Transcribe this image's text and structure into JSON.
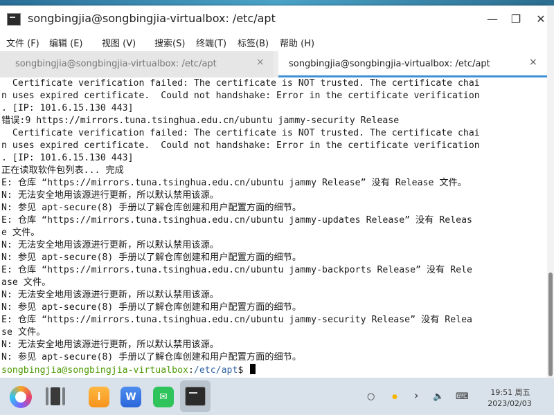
{
  "window": {
    "title": "songbingjia@songbingjia-virtualbox: /etc/apt",
    "minimize_icon": "minimize-icon",
    "maximize_icon": "maximize-icon",
    "close_icon": "close-icon",
    "minimize_glyph": "—",
    "maximize_glyph": "❐",
    "close_glyph": "✕"
  },
  "menu": [
    {
      "label": "文件 (F)"
    },
    {
      "label": "编辑 (E)"
    },
    {
      "label": "视图 (V)"
    },
    {
      "label": "搜索(S)"
    },
    {
      "label": "终端(T)"
    },
    {
      "label": "标签(B)"
    },
    {
      "label": "帮助 (H)"
    }
  ],
  "tabs": [
    {
      "label": "songbingjia@songbingjia-virtualbox: /etc/apt",
      "close": "×",
      "active": false
    },
    {
      "label": "songbingjia@songbingjia-virtualbox: /etc/apt",
      "close": "×",
      "active": true
    }
  ],
  "terminal": {
    "lines": [
      "  Certificate verification failed: The certificate is NOT trusted. The certificate chai",
      "n uses expired certificate.  Could not handshake: Error in the certificate verification",
      ". [IP: 101.6.15.130 443]",
      "错误:9 https://mirrors.tuna.tsinghua.edu.cn/ubuntu jammy-security Release",
      "  Certificate verification failed: The certificate is NOT trusted. The certificate chai",
      "n uses expired certificate.  Could not handshake: Error in the certificate verification",
      ". [IP: 101.6.15.130 443]",
      "正在读取软件包列表... 完成",
      "E: 仓库 “https://mirrors.tuna.tsinghua.edu.cn/ubuntu jammy Release” 没有 Release 文件。",
      "N: 无法安全地用该源进行更新，所以默认禁用该源。",
      "N: 参见 apt-secure(8) 手册以了解仓库创建和用户配置方面的细节。",
      "E: 仓库 “https://mirrors.tuna.tsinghua.edu.cn/ubuntu jammy-updates Release” 没有 Releas",
      "e 文件。",
      "N: 无法安全地用该源进行更新，所以默认禁用该源。",
      "N: 参见 apt-secure(8) 手册以了解仓库创建和用户配置方面的细节。",
      "E: 仓库 “https://mirrors.tuna.tsinghua.edu.cn/ubuntu jammy-backports Release” 没有 Rele",
      "ase 文件。",
      "N: 无法安全地用该源进行更新，所以默认禁用该源。",
      "N: 参见 apt-secure(8) 手册以了解仓库创建和用户配置方面的细节。",
      "E: 仓库 “https://mirrors.tuna.tsinghua.edu.cn/ubuntu jammy-security Release” 没有 Relea",
      "se 文件。",
      "N: 无法安全地用该源进行更新，所以默认禁用该源。",
      "N: 参见 apt-secure(8) 手册以了解仓库创建和用户配置方面的细节。"
    ],
    "prompt_user": "songbingjia@songbingjia-virtualbox",
    "prompt_sep": ":",
    "prompt_path": "/etc/apt",
    "prompt_symbol": "$ "
  },
  "colors": {
    "prompt_user": "#4e9a06",
    "prompt_path": "#3465a4",
    "tab_active_underline": "#3d8fd6"
  },
  "taskbar": {
    "apps": [
      {
        "name": "start-menu-icon"
      },
      {
        "name": "multitask-view-icon"
      },
      {
        "name": "file-manager-icon",
        "glyph": "i"
      },
      {
        "name": "wps-office-icon",
        "glyph": "W"
      },
      {
        "name": "wechat-icon",
        "glyph": "✉"
      },
      {
        "name": "terminal-app-icon"
      }
    ],
    "tray": {
      "search_glyph": "○",
      "status_glyph": "●",
      "expand_glyph": "›",
      "volume_glyph": "🔈",
      "keyboard_glyph": "⌨"
    },
    "clock_time": "19:51 周五",
    "clock_date": "2023/02/03"
  }
}
